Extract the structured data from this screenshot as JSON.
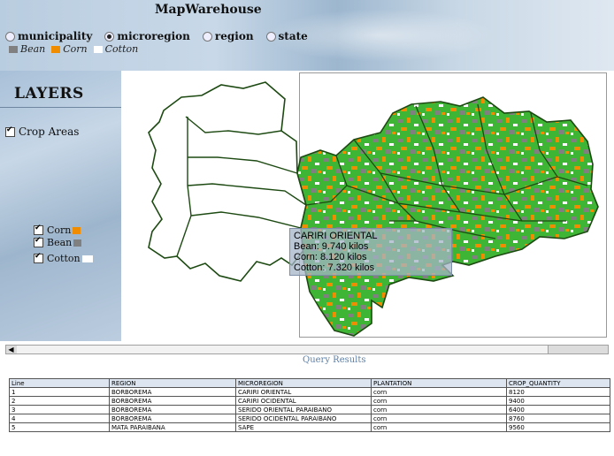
{
  "app": {
    "title": "MapWarehouse"
  },
  "levels": [
    {
      "label": "municipality",
      "selected": false
    },
    {
      "label": "microregion",
      "selected": true
    },
    {
      "label": "region",
      "selected": false
    },
    {
      "label": "state",
      "selected": false
    }
  ],
  "legend": [
    {
      "label": "Bean",
      "color": "#808080"
    },
    {
      "label": "Corn",
      "color": "#f08c00"
    },
    {
      "label": "Cotton",
      "color": "#ffffff"
    }
  ],
  "layers": {
    "title": "LAYERS",
    "crop_areas": "Crop Areas",
    "items": [
      {
        "label": "Corn",
        "color": "#f08c00"
      },
      {
        "label": "Bean",
        "color": "#808080"
      },
      {
        "label": "Cotton",
        "color": "#ffffff"
      }
    ]
  },
  "tooltip": {
    "title": "CARIRI ORIENTAL",
    "bean": "Bean: 9.740 kilos",
    "corn": "Corn: 8.120 kilos",
    "cotton": "Cotton: 7.320 kilos"
  },
  "query": {
    "title": "Query Results",
    "columns": [
      "Line",
      "REGION",
      "MICROREGION",
      "PLANTATION",
      "CROP_QUANTITY"
    ],
    "rows": [
      [
        "1",
        "BORBOREMA",
        "CARIRI ORIENTAL",
        "corn",
        "8120"
      ],
      [
        "2",
        "BORBOREMA",
        "CARIRI OCIDENTAL",
        "corn",
        "9400"
      ],
      [
        "3",
        "BORBOREMA",
        "SERIDO ORIENTAL PARAIBANO",
        "corn",
        "6400"
      ],
      [
        "4",
        "BORBOREMA",
        "SERIDO OCIDENTAL PARAIBANO",
        "corn",
        "8760"
      ],
      [
        "5",
        "MATA PARAIBANA",
        "SAPE",
        "corn",
        "9560"
      ]
    ]
  },
  "colors": {
    "map_green": "#3fb536",
    "map_border": "#1d4a12"
  }
}
